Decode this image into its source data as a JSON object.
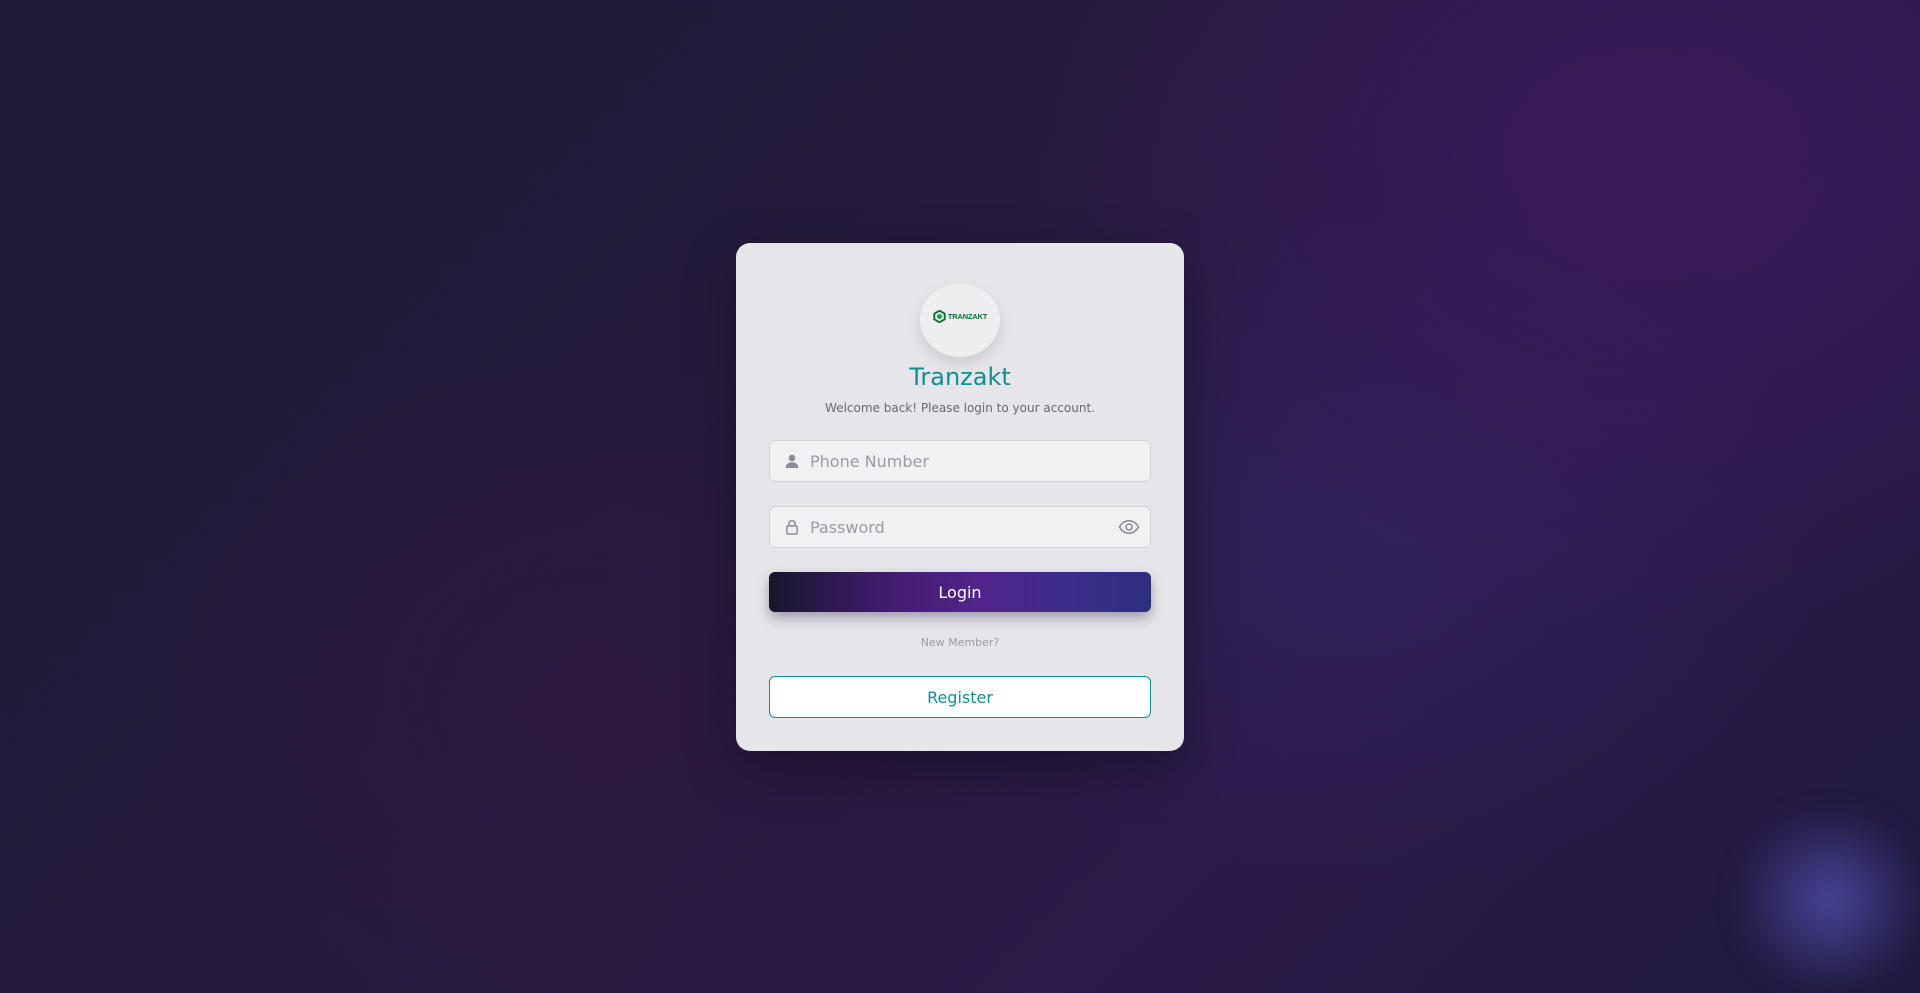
{
  "app": {
    "name": "Tranzakt",
    "welcome": "Welcome back! Please login to your account.",
    "logo_text": "TRANZAKT"
  },
  "form": {
    "phone": {
      "placeholder": "Phone Number",
      "value": "",
      "icon": "user-icon"
    },
    "password": {
      "placeholder": "Password",
      "value": "",
      "icon": "lock-icon",
      "toggle_icon": "eye-icon"
    },
    "login_label": "Login",
    "new_member_text": "New Member?",
    "register_label": "Register"
  },
  "colors": {
    "accent": "#0f8f8f",
    "card_background": "#e6e6ea",
    "logo_green": "#0b6e2b"
  }
}
